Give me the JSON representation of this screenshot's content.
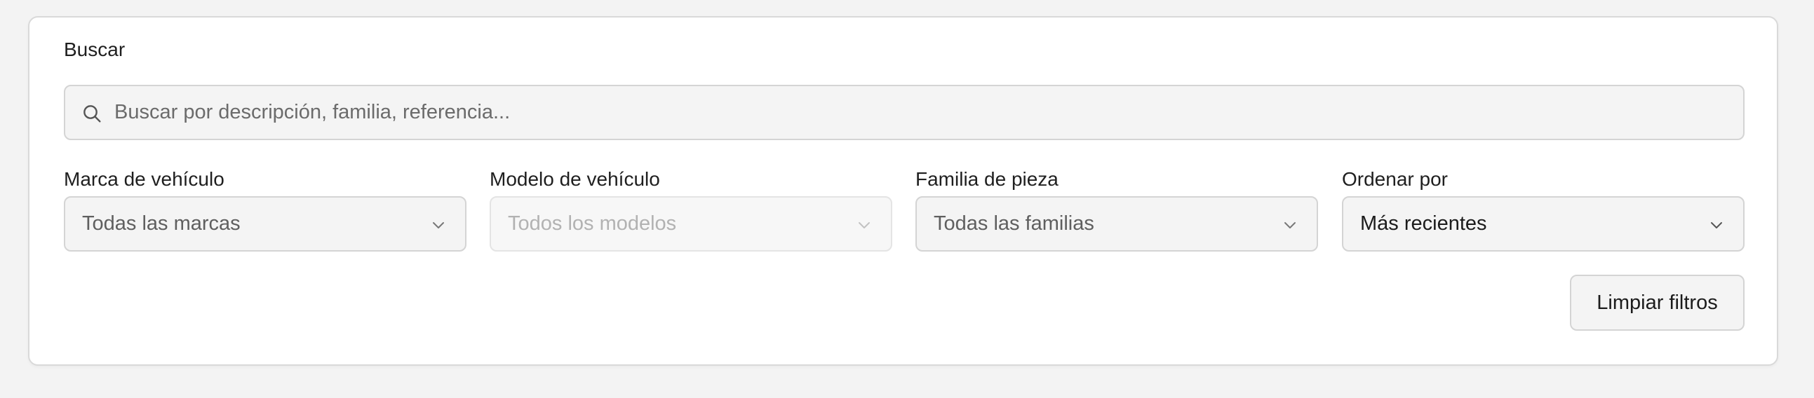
{
  "search": {
    "label": "Buscar",
    "placeholder": "Buscar por descripción, familia, referencia...",
    "value": "",
    "icon": "search-icon"
  },
  "filters": {
    "brand": {
      "label": "Marca de vehículo",
      "selected": "Todas las marcas",
      "disabled": false
    },
    "model": {
      "label": "Modelo de vehículo",
      "selected": "Todos los modelos",
      "disabled": true
    },
    "family": {
      "label": "Familia de pieza",
      "selected": "Todas las familias",
      "disabled": false
    },
    "sort": {
      "label": "Ordenar por",
      "selected": "Más recientes",
      "disabled": false
    }
  },
  "actions": {
    "clear_label": "Limpiar filtros"
  },
  "colors": {
    "page_background": "#f3f3f3",
    "card_background": "#ffffff",
    "field_background": "#f4f4f4",
    "border": "#d4d4d4",
    "placeholder_text": "#6b6b6b",
    "disabled_text": "#b2b2b2"
  }
}
